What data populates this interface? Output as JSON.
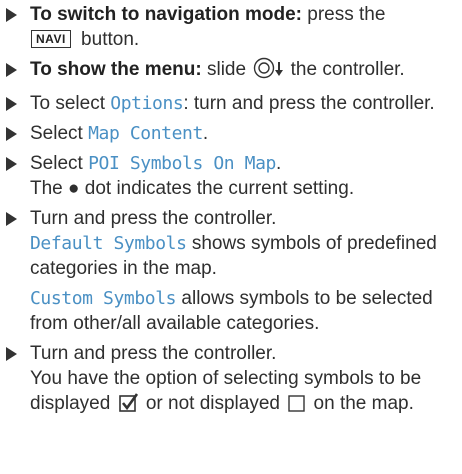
{
  "steps": [
    {
      "bold": "To switch to navigation mode:",
      "text": " press the",
      "key": "NAVI",
      "text2": " button."
    },
    {
      "bold": "To show the menu:",
      "text": " slide ",
      "text2": " the controller."
    },
    {
      "text": "To select ",
      "ui": "Options",
      "text2": ": turn and press the controller."
    },
    {
      "text": "Select ",
      "ui": "Map Content",
      "text2": "."
    },
    {
      "text": "Select ",
      "ui": "POI Symbols On Map",
      "text2": ".",
      "line2": "The ● dot indicates the current setting."
    },
    {
      "text": "Turn and press the controller.",
      "ui1": "Default Symbols",
      "desc1": " shows symbols of predefined categories in the map.",
      "ui2": "Custom Symbols",
      "desc2": " allows symbols to be selected from other/all available categories."
    },
    {
      "text": "Turn and press the controller.",
      "line2a": "You have the option of selecting symbols to be displayed ",
      "line2b": " or not displayed ",
      "line2c": " on the map."
    }
  ],
  "icons": {
    "arrow": "bullet-arrow-icon",
    "controller": "controller-slide-down-icon",
    "checked": "checkbox-checked-icon",
    "unchecked": "checkbox-unchecked-icon"
  },
  "colors": {
    "ui_text": "#4a90c4",
    "body_text": "#2f2f2f"
  }
}
